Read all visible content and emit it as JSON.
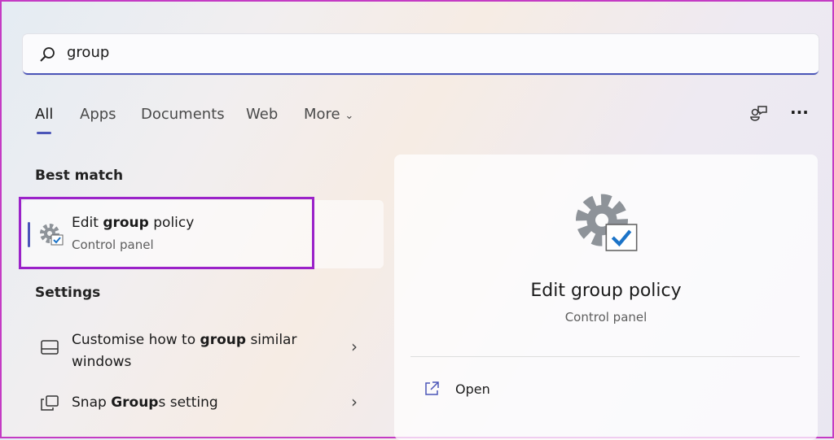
{
  "search": {
    "value": "group",
    "icon": "search-icon"
  },
  "tabs": [
    {
      "label": "All",
      "active": true
    },
    {
      "label": "Apps"
    },
    {
      "label": "Documents"
    },
    {
      "label": "Web"
    },
    {
      "label": "More"
    }
  ],
  "toolbar": {
    "feedback_icon": "people-feedback-icon",
    "more_icon": "more-dots-icon"
  },
  "best_match": {
    "heading": "Best match",
    "title_pre": "Edit ",
    "title_bold": "group",
    "title_post": " policy",
    "subtitle": "Control panel",
    "icon": "gear-check-icon"
  },
  "settings": {
    "heading": "Settings",
    "items": [
      {
        "pre": "Customise how to ",
        "bold": "group",
        "post": " similar",
        "line2": "windows",
        "icon": "window-taskbar-icon"
      },
      {
        "pre": "Snap ",
        "bold": "Group",
        "post": "s setting",
        "icon": "snap-windows-icon"
      }
    ]
  },
  "detail": {
    "title": "Edit group policy",
    "subtitle": "Control panel",
    "actions": [
      {
        "label": "Open",
        "icon": "open-external-icon"
      }
    ]
  },
  "colors": {
    "accent": "#4b55b8",
    "highlight": "#9b22c9"
  }
}
